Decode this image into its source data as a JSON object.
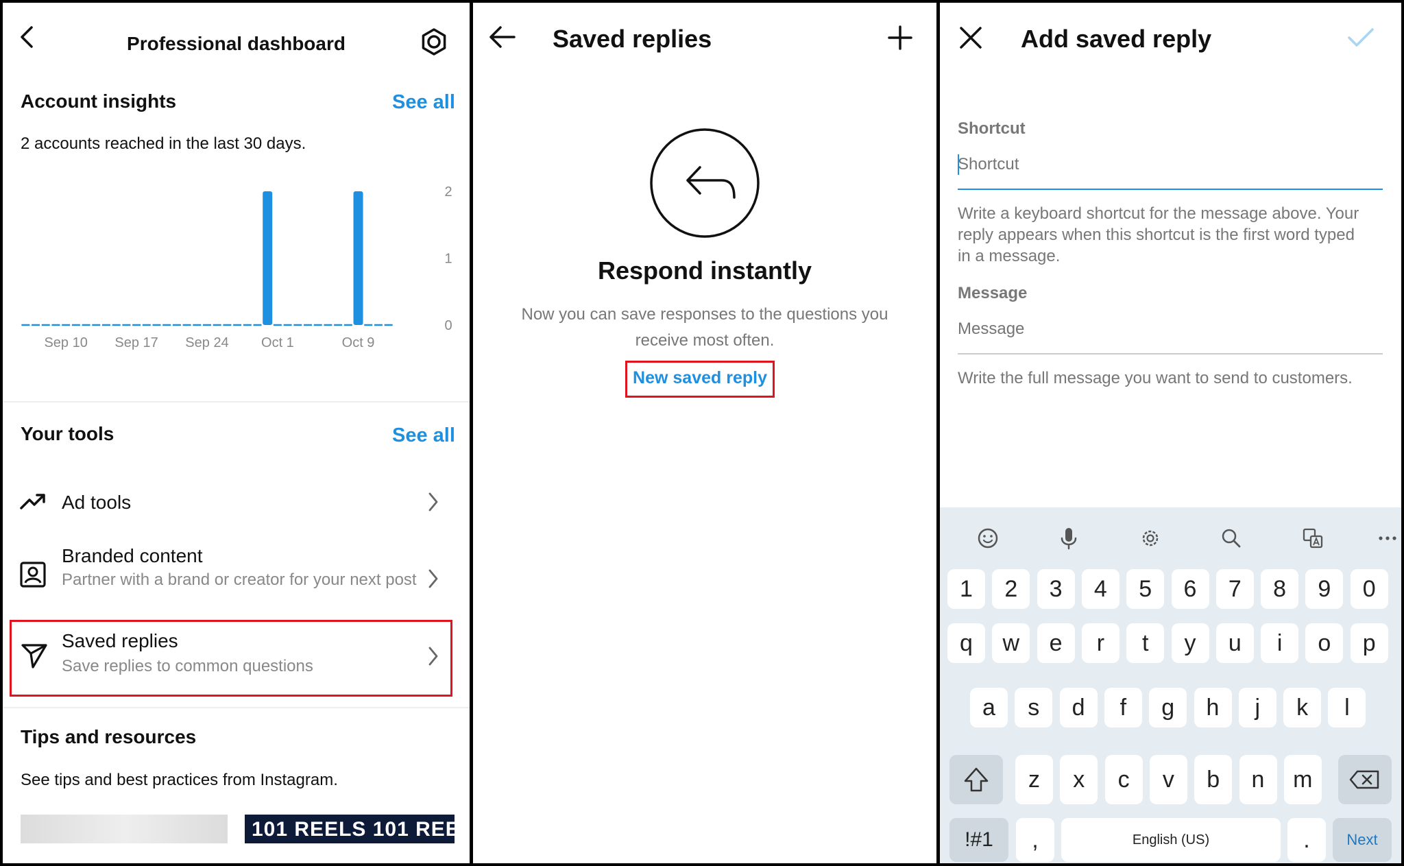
{
  "panel1": {
    "title": "Professional dashboard",
    "insights": {
      "title": "Account insights",
      "see_all": "See all",
      "summary": "2 accounts reached in the last 30 days."
    },
    "tools": {
      "title": "Your tools",
      "see_all": "See all",
      "items": [
        {
          "label": "Ad tools",
          "sub": ""
        },
        {
          "label": "Branded content",
          "sub": "Partner with a brand or creator for your next post"
        },
        {
          "label": "Saved replies",
          "sub": "Save replies to common questions"
        }
      ]
    },
    "tips": {
      "title": "Tips and resources",
      "text": "See tips and best practices from Instagram.",
      "thumb_text": "101 REELS 101 REEL"
    }
  },
  "chart_data": {
    "type": "bar",
    "x": [
      "Sep 6",
      "Sep 7",
      "Sep 8",
      "Sep 9",
      "Sep 10",
      "Sep 11",
      "Sep 12",
      "Sep 13",
      "Sep 14",
      "Sep 15",
      "Sep 16",
      "Sep 17",
      "Sep 18",
      "Sep 19",
      "Sep 20",
      "Sep 21",
      "Sep 22",
      "Sep 23",
      "Sep 24",
      "Sep 25",
      "Sep 26",
      "Sep 27",
      "Sep 28",
      "Sep 29",
      "Sep 30",
      "Oct 1",
      "Oct 2",
      "Oct 3",
      "Oct 4",
      "Oct 5",
      "Oct 6",
      "Oct 7",
      "Oct 8",
      "Oct 9",
      "Oct 10",
      "Oct 11",
      "Oct 12"
    ],
    "values": [
      0,
      0,
      0,
      0,
      0,
      0,
      0,
      0,
      0,
      0,
      0,
      0,
      0,
      0,
      0,
      0,
      0,
      0,
      0,
      0,
      0,
      0,
      0,
      0,
      2,
      0,
      0,
      0,
      0,
      0,
      0,
      0,
      0,
      2,
      0,
      0,
      0
    ],
    "xticks": [
      "Sep 10",
      "Sep 17",
      "Sep 24",
      "Oct 1",
      "Oct 9"
    ],
    "yticks": [
      "2",
      "1",
      "0"
    ],
    "ylim": [
      0,
      2
    ],
    "color": "#1f8fe0"
  },
  "panel2": {
    "title": "Saved replies",
    "heading": "Respond instantly",
    "desc_line1": "Now you can save responses to the questions you",
    "desc_line2": "receive most often.",
    "link": "New saved reply"
  },
  "panel3": {
    "title": "Add saved reply",
    "shortcut_label": "Shortcut",
    "shortcut_placeholder": "Shortcut",
    "shortcut_help_1": "Write a keyboard shortcut for the message above. Your",
    "shortcut_help_2": "reply appears when this shortcut is the first word typed",
    "shortcut_help_3": "in a message.",
    "message_label": "Message",
    "message_placeholder": "Message",
    "message_help": "Write the full message you want to send to customers."
  },
  "keyboard": {
    "row_numbers": [
      "1",
      "2",
      "3",
      "4",
      "5",
      "6",
      "7",
      "8",
      "9",
      "0"
    ],
    "row1": [
      "q",
      "w",
      "e",
      "r",
      "t",
      "y",
      "u",
      "i",
      "o",
      "p"
    ],
    "row2": [
      "a",
      "s",
      "d",
      "f",
      "g",
      "h",
      "j",
      "k",
      "l"
    ],
    "row3": [
      "z",
      "x",
      "c",
      "v",
      "b",
      "n",
      "m"
    ],
    "symbols": "!#1",
    "comma": ",",
    "space": "English (US)",
    "period": ".",
    "next": "Next"
  },
  "colors": {
    "accent": "#1f8fe0",
    "highlight": "#e0141e",
    "keyboard_bg": "#e6edf2"
  }
}
